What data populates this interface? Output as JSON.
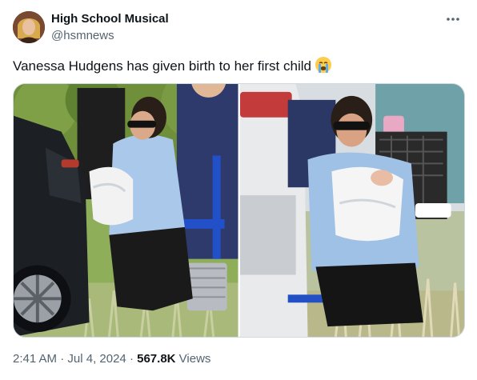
{
  "author": {
    "name": "High School Musical",
    "handle": "@hsmnews"
  },
  "tweet": {
    "text": "Vanessa Hudgens has given birth to her first child",
    "emoji": "crying-face-emoji"
  },
  "media": {
    "count": 2
  },
  "meta": {
    "time": "2:41 AM",
    "separator": "·",
    "date": "Jul 4, 2024",
    "views_count": "567.8K",
    "views_label": "Views"
  },
  "icons": {
    "more": "more-horizontal-icon"
  },
  "colors": {
    "text_primary": "#0f1419",
    "text_secondary": "#536471",
    "border": "#cfd9de"
  }
}
